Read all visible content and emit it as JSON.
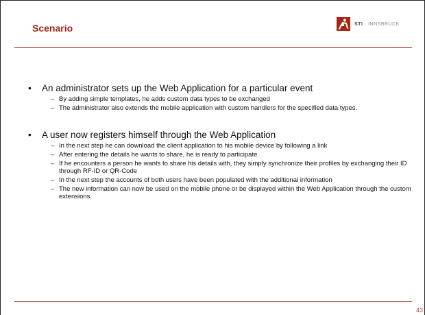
{
  "header": {
    "title": "Scenario",
    "logo_text_bold": "STI",
    "logo_text_rest": " · INNSBRUCK"
  },
  "bullets": [
    {
      "text": "An administrator sets up the Web Application for a particular event",
      "subs": [
        "By adding simple templates, he adds custom data types to be exchanged",
        "The administrator also extends the mobile application with custom handlers for the specified data types."
      ]
    },
    {
      "text": "A user now registers himself through the Web Application",
      "subs": [
        "In the next step he can download the client application to his mobile device by following a link",
        "After entering the details he wants to share, he is ready to participate",
        "If he encounters a person he wants to share his details with, they simply synchronize their profiles by exchanging their ID through RF-ID or QR-Code",
        "In the next step the accounts of both users have been populated with the additional information",
        "The new information can now be used on the mobile phone or be displayed within the Web Application through the custom extensions."
      ]
    }
  ],
  "footer": {
    "page_number": "43"
  }
}
